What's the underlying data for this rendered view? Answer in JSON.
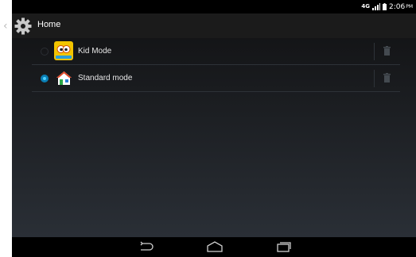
{
  "status_bar": {
    "network": "4G",
    "time": "2:06",
    "ampm": "PM"
  },
  "action_bar": {
    "title": "Home",
    "icon": "gear-icon"
  },
  "home_options": [
    {
      "label": "Kid Mode",
      "selected": false,
      "icon": "kid-mode-icon"
    },
    {
      "label": "Standard mode",
      "selected": true,
      "icon": "house-icon"
    }
  ],
  "nav_bar": {
    "buttons": [
      "back-icon",
      "home-icon",
      "recent-apps-icon"
    ]
  },
  "colors": {
    "accent": "#0a7fb5",
    "action_bar_bg": "#1b1b1b",
    "content_top": "#141517",
    "content_bottom": "#2a2f36"
  }
}
